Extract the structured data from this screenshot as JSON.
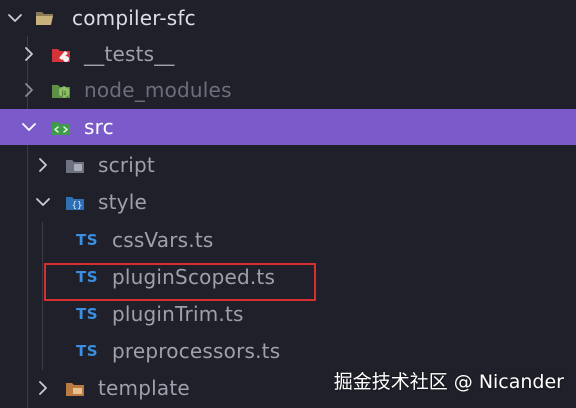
{
  "tree": {
    "root": {
      "label": "compiler-sfc",
      "expanded": true,
      "icon": "folder-open-icon"
    },
    "items": [
      {
        "label": "__tests__",
        "kind": "folder",
        "expanded": false,
        "icon": "test-folder-icon",
        "color": "#d2343a"
      },
      {
        "label": "node_modules",
        "kind": "folder",
        "expanded": false,
        "icon": "node-folder-icon",
        "color": "#6aa84f"
      },
      {
        "label": "src",
        "kind": "folder",
        "expanded": true,
        "selected": true,
        "icon": "src-folder-icon",
        "color": "#4caf50"
      },
      {
        "label": "script",
        "kind": "folder",
        "expanded": false,
        "icon": "script-folder-icon",
        "color": "#7a7f8c"
      },
      {
        "label": "style",
        "kind": "folder",
        "expanded": true,
        "icon": "style-folder-icon",
        "color": "#3b8ee0"
      },
      {
        "label": "cssVars.ts",
        "kind": "file",
        "badge": "TS"
      },
      {
        "label": "pluginScoped.ts",
        "kind": "file",
        "badge": "TS",
        "highlighted": true
      },
      {
        "label": "pluginTrim.ts",
        "kind": "file",
        "badge": "TS"
      },
      {
        "label": "preprocessors.ts",
        "kind": "file",
        "badge": "TS"
      },
      {
        "label": "template",
        "kind": "folder",
        "expanded": false,
        "icon": "template-folder-icon",
        "color": "#c9884a"
      }
    ]
  },
  "colors": {
    "background": "#1f2029",
    "selection": "#7b5ac9",
    "highlight_border": "#d4302f",
    "ts_badge": "#3b8ee0"
  },
  "watermark": "掘金技术社区 @ Nicander"
}
